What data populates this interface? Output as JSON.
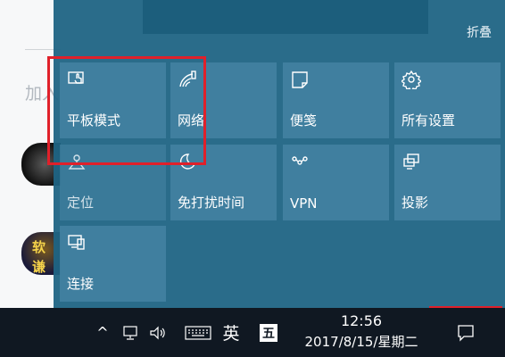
{
  "background_app": {
    "add_text": "加入",
    "avatar_text_1": "软",
    "avatar_text_2": "谦"
  },
  "action_center": {
    "collapse_label": "折叠",
    "tiles": [
      {
        "label": "平板模式",
        "icon": "tablet-mode-icon"
      },
      {
        "label": "网络",
        "icon": "network-icon"
      },
      {
        "label": "便笺",
        "icon": "note-icon"
      },
      {
        "label": "所有设置",
        "icon": "settings-gear-icon"
      },
      {
        "label": "定位",
        "icon": "location-icon"
      },
      {
        "label": "免打扰时间",
        "icon": "quiet-hours-moon-icon"
      },
      {
        "label": "VPN",
        "icon": "vpn-icon"
      },
      {
        "label": "投影",
        "icon": "project-icon"
      },
      {
        "label": "连接",
        "icon": "connect-icon"
      }
    ]
  },
  "taskbar": {
    "chevron": "^",
    "ime_label": "英",
    "wubi_label": "五",
    "time": "12:56",
    "date": "2017/8/15/星期二"
  },
  "colors": {
    "panel": "#1f6484",
    "tile": "#4482a2",
    "taskbar": "#101822",
    "highlight": "#e0202a"
  }
}
